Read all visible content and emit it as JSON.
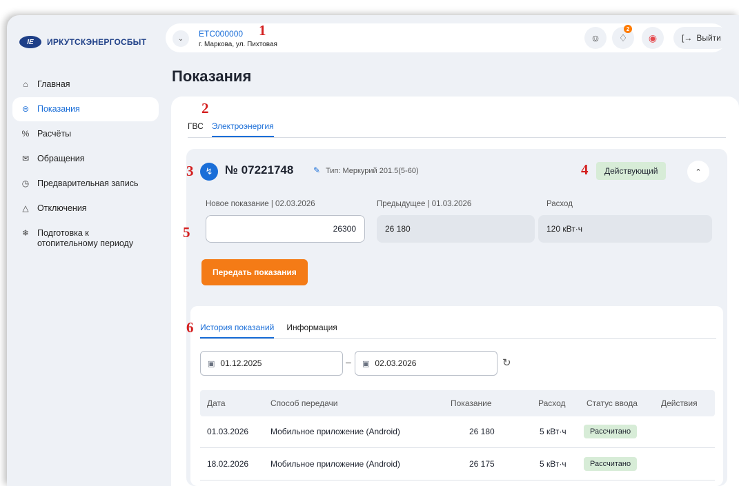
{
  "brand": {
    "logo_text": "ИРКУТСКЭНЕРГОСБЫТ"
  },
  "account": {
    "code": "ETC000000",
    "address": "г. Маркова, ул. Пихтовая"
  },
  "header": {
    "notifications_count": "2",
    "logout_label": "Выйти"
  },
  "sidebar": {
    "items": [
      {
        "label": "Главная",
        "icon": "home-icon",
        "active": false
      },
      {
        "label": "Показания",
        "icon": "meter-icon",
        "active": true
      },
      {
        "label": "Расчёты",
        "icon": "percent-icon",
        "active": false
      },
      {
        "label": "Обращения",
        "icon": "mail-icon",
        "active": false
      },
      {
        "label": "Предварительная запись",
        "icon": "clock-icon",
        "active": false
      },
      {
        "label": "Отключения",
        "icon": "warning-icon",
        "active": false
      },
      {
        "label": "Подготовка к отопительному периоду",
        "icon": "snowflake-icon",
        "active": false
      }
    ]
  },
  "page": {
    "title": "Показания"
  },
  "service_tabs": [
    {
      "label": "ГВС",
      "active": false
    },
    {
      "label": "Электроэнергия",
      "active": true
    }
  ],
  "meter": {
    "number": "№ 07221748",
    "type": "Тип: Меркурий 201.5(5-60)",
    "status": "Действующий",
    "new_reading_label": "Новое показание | 02.03.2026",
    "new_reading_value": "26300",
    "previous_label": "Предыдущее | 01.03.2026",
    "previous_value": "26 180",
    "consumption_label": "Расход",
    "consumption_value": "120 кВт·ч",
    "submit_label": "Передать показания"
  },
  "history": {
    "tabs": [
      {
        "label": "История показаний",
        "active": true
      },
      {
        "label": "Информация",
        "active": false
      }
    ],
    "date_from": "01.12.2025",
    "date_to": "02.03.2026",
    "columns": [
      "Дата",
      "Способ передачи",
      "Показание",
      "Расход",
      "Статус ввода",
      "Действия"
    ],
    "rows": [
      {
        "date": "01.03.2026",
        "method": "Мобильное приложение (Android)",
        "reading": "26 180",
        "consumption": "5 кВт·ч",
        "status": "Рассчитано"
      },
      {
        "date": "18.02.2026",
        "method": "Мобильное приложение (Android)",
        "reading": "26 175",
        "consumption": "5 кВт·ч",
        "status": "Рассчитано"
      }
    ]
  },
  "annotations": [
    "1",
    "2",
    "3",
    "4",
    "5",
    "6"
  ],
  "colors": {
    "accent": "#1a6ed8",
    "primary_button": "#f47b16",
    "status_bg": "#d7ecd7",
    "badge": "#ff7a00",
    "marker": "#d41f1f"
  }
}
